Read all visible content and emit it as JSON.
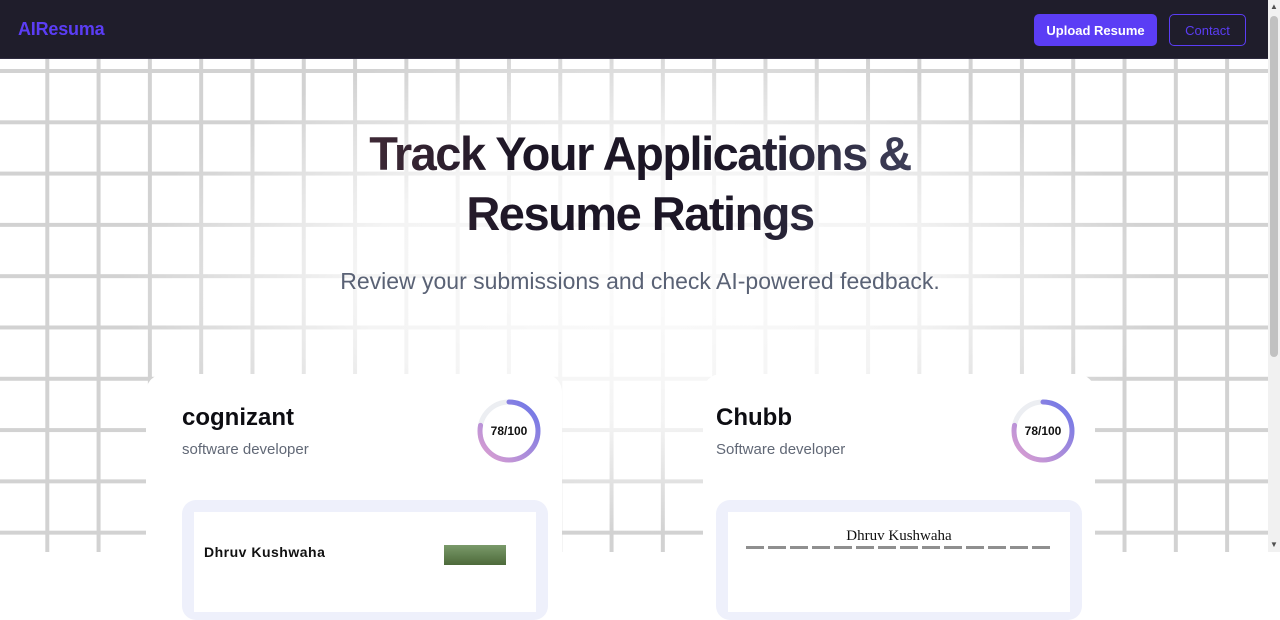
{
  "nav": {
    "logo": "AIResuma",
    "upload_label": "Upload Resume",
    "contact_label": "Contact"
  },
  "hero": {
    "title_line1": "Track Your Applications &",
    "title_line2": "Resume Ratings",
    "subtitle": "Review your submissions and check AI-powered feedback."
  },
  "colors": {
    "brand": "#5b3df5",
    "navbar_bg": "#1f1d2b",
    "ring_gradient_start": "#d49ad6",
    "ring_gradient_end": "#6a75e8"
  },
  "cards": [
    {
      "company": "cognizant",
      "role": "software developer",
      "score_text": "78/100",
      "score_fraction": 0.78,
      "preview_name": "Dhruv Kushwaha"
    },
    {
      "company": "Chubb",
      "role": "Software developer",
      "score_text": "78/100",
      "score_fraction": 0.78,
      "preview_name": "Dhruv Kushwaha"
    }
  ],
  "scrollbar": {
    "up_icon": "arrow-up-icon",
    "down_icon": "arrow-down-icon"
  }
}
